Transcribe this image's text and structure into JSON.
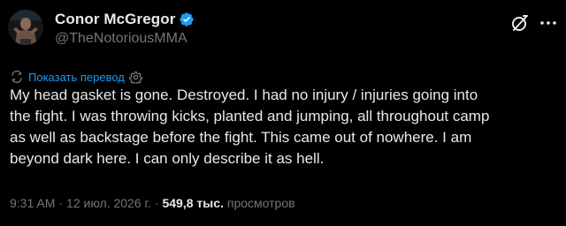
{
  "author": {
    "display_name": "Conor McGregor",
    "handle": "@TheNotoriousMMA",
    "verified": true,
    "avatar_icon": "profile-photo",
    "verified_icon": "verified-badge-icon"
  },
  "actions": {
    "grok_icon": "grok-icon",
    "more_icon": "more-options-icon"
  },
  "translate": {
    "label": "Показать перевод",
    "icon": "translate-icon",
    "settings_icon": "gear-icon"
  },
  "tweet": {
    "text": "My head gasket is gone. Destroyed. I had no injury / injuries going into\nthe fight. I was throwing kicks, planted and jumping, all throughout camp\nas well as backstage before the fight. This came out of nowhere. I am\nbeyond dark here. I can only describe it as hell."
  },
  "meta": {
    "time": "9:31 AM",
    "separator": "·",
    "date": "12 июл. 2026 г.",
    "views_count": "549,8 тыс.",
    "views_label": "просмотров"
  },
  "colors": {
    "background": "#000000",
    "text_primary": "#e7e9ea",
    "text_secondary": "#71767b",
    "accent": "#1d9bf0"
  }
}
